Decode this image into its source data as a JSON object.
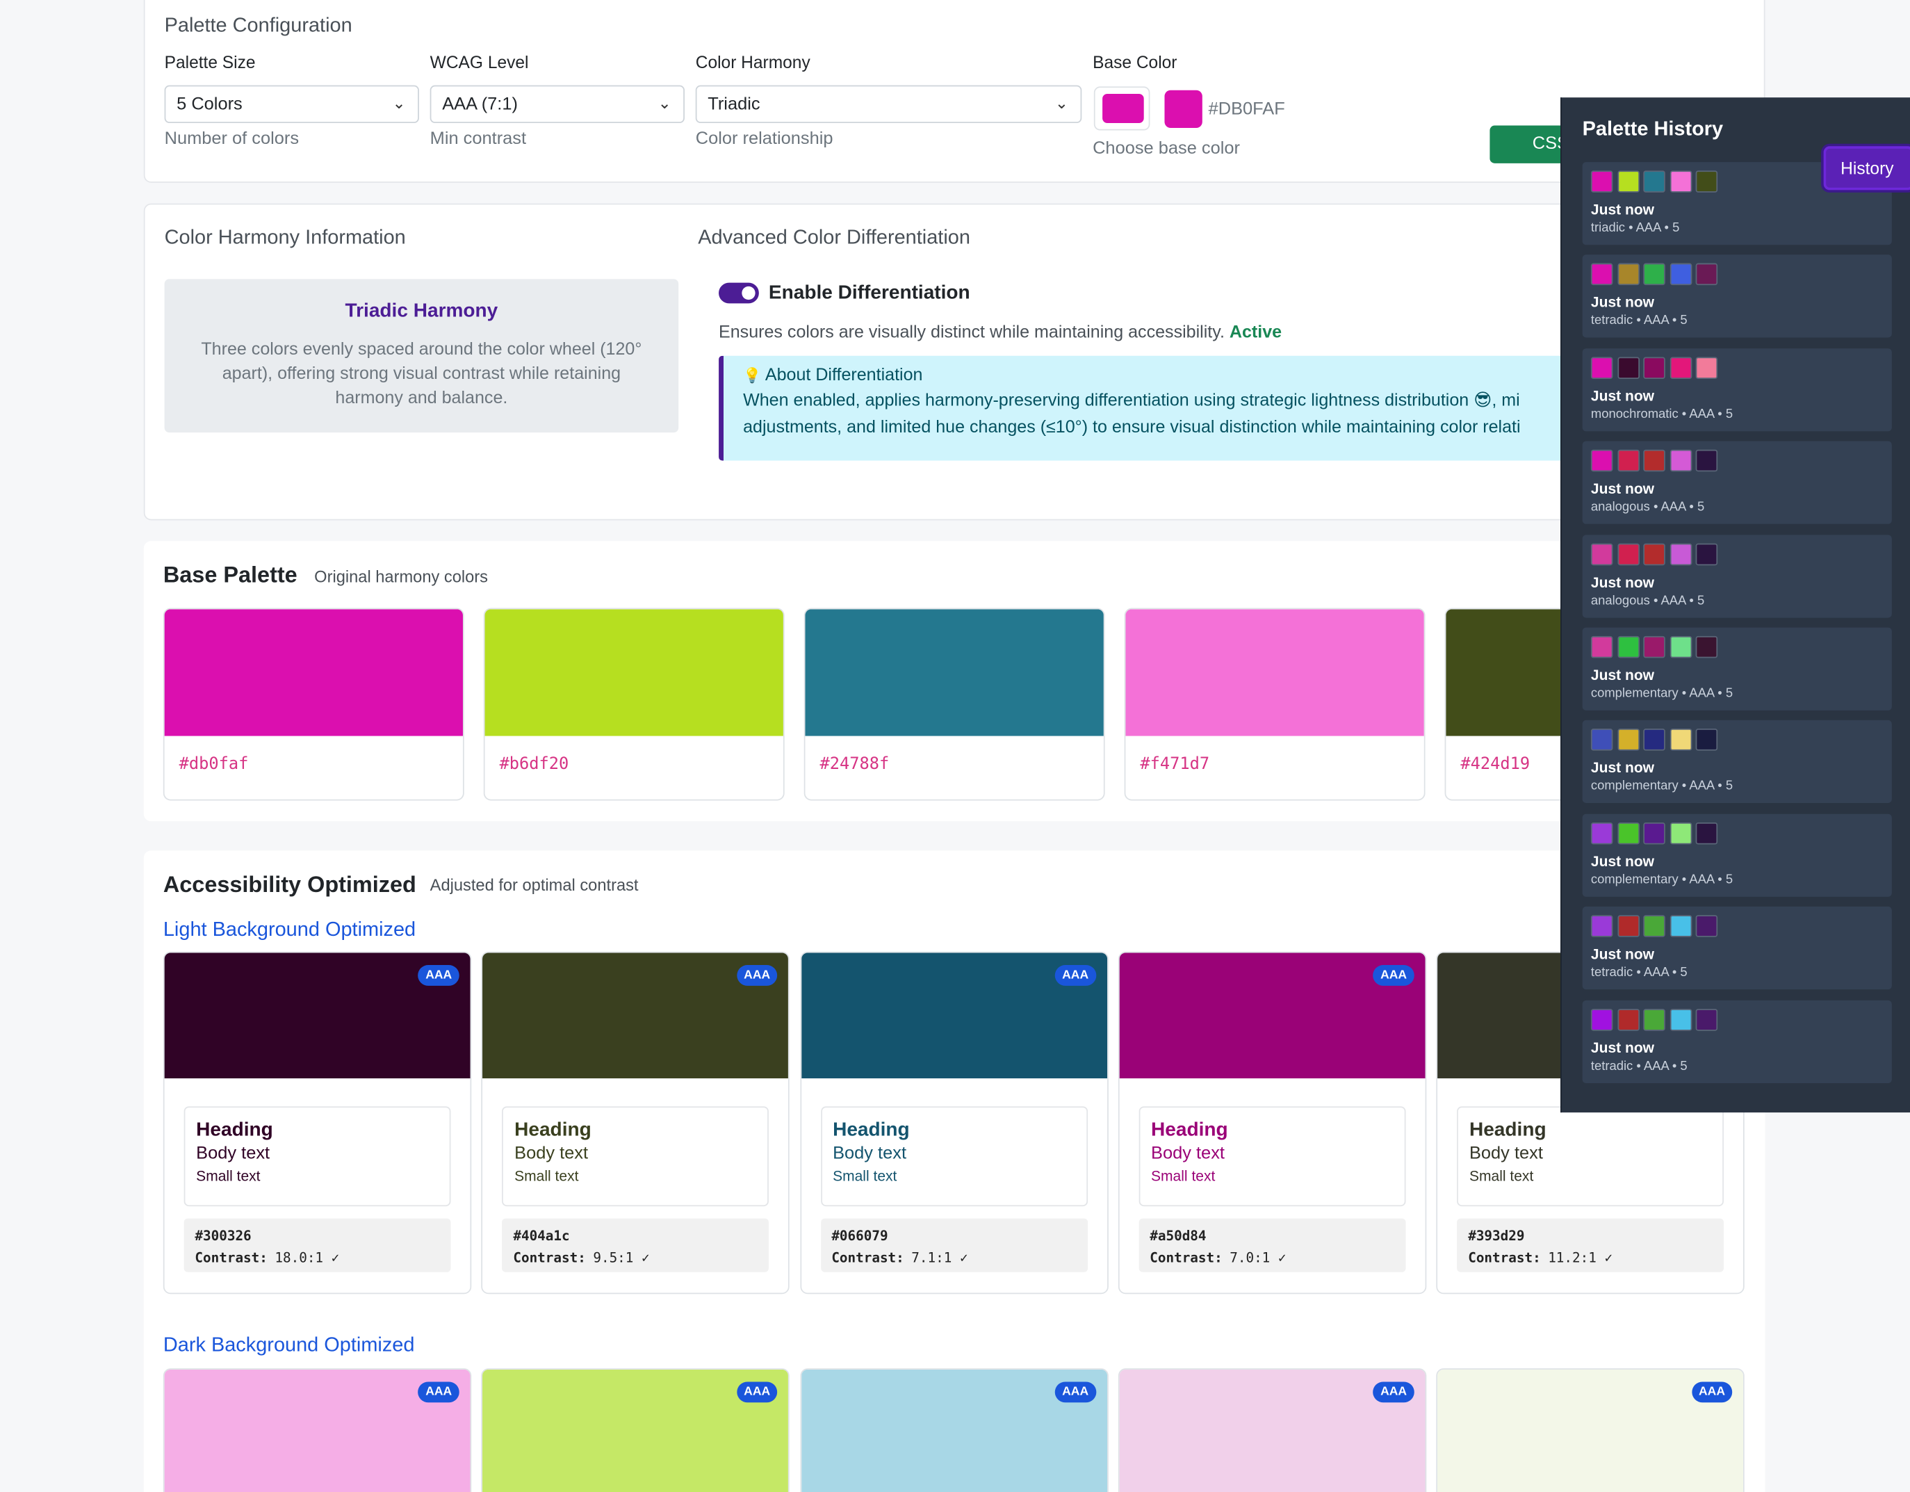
{
  "config": {
    "title": "Palette Configuration",
    "size_label": "Palette Size",
    "size_value": "5 Colors",
    "size_help": "Number of colors",
    "wcag_label": "WCAG Level",
    "wcag_value": "AAA (7:1)",
    "wcag_help": "Min contrast",
    "harmony_label": "Color Harmony",
    "harmony_value": "Triadic",
    "harmony_help": "Color relationship",
    "base_label": "Base Color",
    "base_hex": "#DB0FAF",
    "base_help": "Choose base color",
    "base_color": "#db0faf",
    "css_button": "CSS"
  },
  "harmony_info": {
    "title": "Color Harmony Information",
    "name": "Triadic Harmony",
    "desc": "Three colors evenly spaced around the color wheel (120° apart), offering strong visual contrast while retaining harmony and balance."
  },
  "differentiation": {
    "title": "Advanced Color Differentiation",
    "toggle_label": "Enable Differentiation",
    "desc": "Ensures colors are visually distinct while maintaining accessibility.",
    "status": "Active",
    "about_icon": "lightbulb-icon",
    "about_title": "About Differentiation",
    "about_text": "When enabled, applies harmony-preserving differentiation using strategic lightness distribution 😎, mi adjustments, and limited hue changes (≤10°) to ensure visual distinction while maintaining color relati"
  },
  "base_palette": {
    "title": "Base Palette",
    "subtitle": "Original harmony colors",
    "colors": [
      {
        "hex": "#db0faf",
        "color": "#db0faf"
      },
      {
        "hex": "#b6df20",
        "color": "#b6df20"
      },
      {
        "hex": "#24788f",
        "color": "#24788f"
      },
      {
        "hex": "#f471d7",
        "color": "#f471d7"
      },
      {
        "hex": "#424d19",
        "color": "#424d19"
      }
    ]
  },
  "accessibility": {
    "title": "Accessibility Optimized",
    "subtitle": "Adjusted for optimal contrast",
    "light_title": "Light Background Optimized",
    "dark_title": "Dark Background Optimized",
    "badge": "AAA",
    "preview": {
      "heading": "Heading",
      "body": "Body text",
      "small": "Small text"
    },
    "contrast_label": "Contrast:",
    "light": [
      {
        "hex": "#300326",
        "color": "#300326",
        "contrast": "18.0:1 ✓"
      },
      {
        "hex": "#404a1c",
        "color": "#3a401f",
        "contrast": "9.5:1 ✓"
      },
      {
        "hex": "#066079",
        "color": "#14546e",
        "contrast": "7.1:1 ✓"
      },
      {
        "hex": "#a50d84",
        "color": "#9a0277",
        "contrast": "7.0:1 ✓"
      },
      {
        "hex": "#393d29",
        "color": "#343628",
        "contrast": "11.2:1 ✓"
      }
    ],
    "dark": [
      {
        "color": "#f5aee6"
      },
      {
        "color": "#c5e866"
      },
      {
        "color": "#a8d7e6"
      },
      {
        "color": "#f1d0ea"
      },
      {
        "color": "#f3f7e8"
      }
    ]
  },
  "history": {
    "title": "Palette History",
    "button": "History",
    "items": [
      {
        "when": "Just now",
        "meta": "triadic • AAA • 5",
        "colors": [
          "#db0faf",
          "#b6df20",
          "#24788f",
          "#f471d7",
          "#424d19"
        ]
      },
      {
        "when": "Just now",
        "meta": "tetradic • AAA • 5",
        "colors": [
          "#db0faf",
          "#a8862a",
          "#2eb04a",
          "#3f5fe0",
          "#6a1a55"
        ]
      },
      {
        "when": "Just now",
        "meta": "monochromatic • AAA • 5",
        "colors": [
          "#db0faf",
          "#3a0a2e",
          "#8a0a5f",
          "#e3177a",
          "#f27b9a"
        ]
      },
      {
        "when": "Just now",
        "meta": "analogous • AAA • 5",
        "colors": [
          "#db0faf",
          "#d1204f",
          "#b32c2c",
          "#d45ad6",
          "#2a1440"
        ]
      },
      {
        "when": "Just now",
        "meta": "analogous • AAA • 5",
        "colors": [
          "#d23a9c",
          "#d1204f",
          "#b32c2c",
          "#c85ad6",
          "#2a1440"
        ]
      },
      {
        "when": "Just now",
        "meta": "complementary • AAA • 5",
        "colors": [
          "#d23a9c",
          "#2ec040",
          "#9a1a6a",
          "#6ee08a",
          "#3a1430"
        ]
      },
      {
        "when": "Just now",
        "meta": "complementary • AAA • 5",
        "colors": [
          "#3f4fb8",
          "#d4b02a",
          "#252a80",
          "#f0d877",
          "#1a1c40"
        ]
      },
      {
        "when": "Just now",
        "meta": "complementary • AAA • 5",
        "colors": [
          "#9a3ad8",
          "#4ac42a",
          "#5a1a90",
          "#8ee878",
          "#2a1440"
        ]
      },
      {
        "when": "Just now",
        "meta": "tetradic • AAA • 5",
        "colors": [
          "#9a3ad8",
          "#b02a2a",
          "#4aa838",
          "#48c0e8",
          "#4a1a6a"
        ]
      },
      {
        "when": "Just now",
        "meta": "tetradic • AAA • 5",
        "colors": [
          "#a012e0",
          "#b02a2a",
          "#4aa838",
          "#48c0e8",
          "#4a1a6a"
        ]
      }
    ]
  }
}
